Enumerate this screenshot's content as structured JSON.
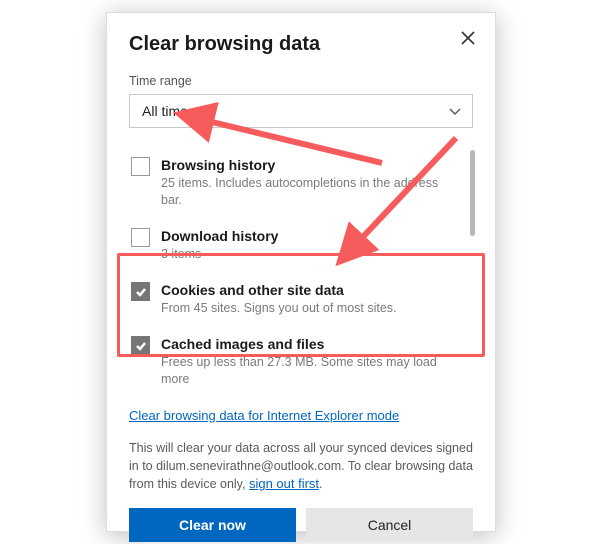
{
  "dialog": {
    "title": "Clear browsing data",
    "time_range_label": "Time range",
    "time_range_value": "All time",
    "options": [
      {
        "title": "Browsing history",
        "sub": "25 items. Includes autocompletions in the address bar.",
        "checked": false
      },
      {
        "title": "Download history",
        "sub": "3 items",
        "checked": false
      },
      {
        "title": "Cookies and other site data",
        "sub": "From 45 sites. Signs you out of most sites.",
        "checked": true
      },
      {
        "title": "Cached images and files",
        "sub": "Frees up less than 27.3 MB. Some sites may load more",
        "checked": true
      }
    ],
    "ie_link": "Clear browsing data for Internet Explorer mode",
    "note_prefix": "This will clear your data across all your synced devices signed in to dilum.senevirathne@outlook.com. To clear browsing data from this device only, ",
    "note_link": "sign out first",
    "note_suffix": ".",
    "clear_label": "Clear now",
    "cancel_label": "Cancel"
  },
  "annotation_color": "#f75c5c"
}
